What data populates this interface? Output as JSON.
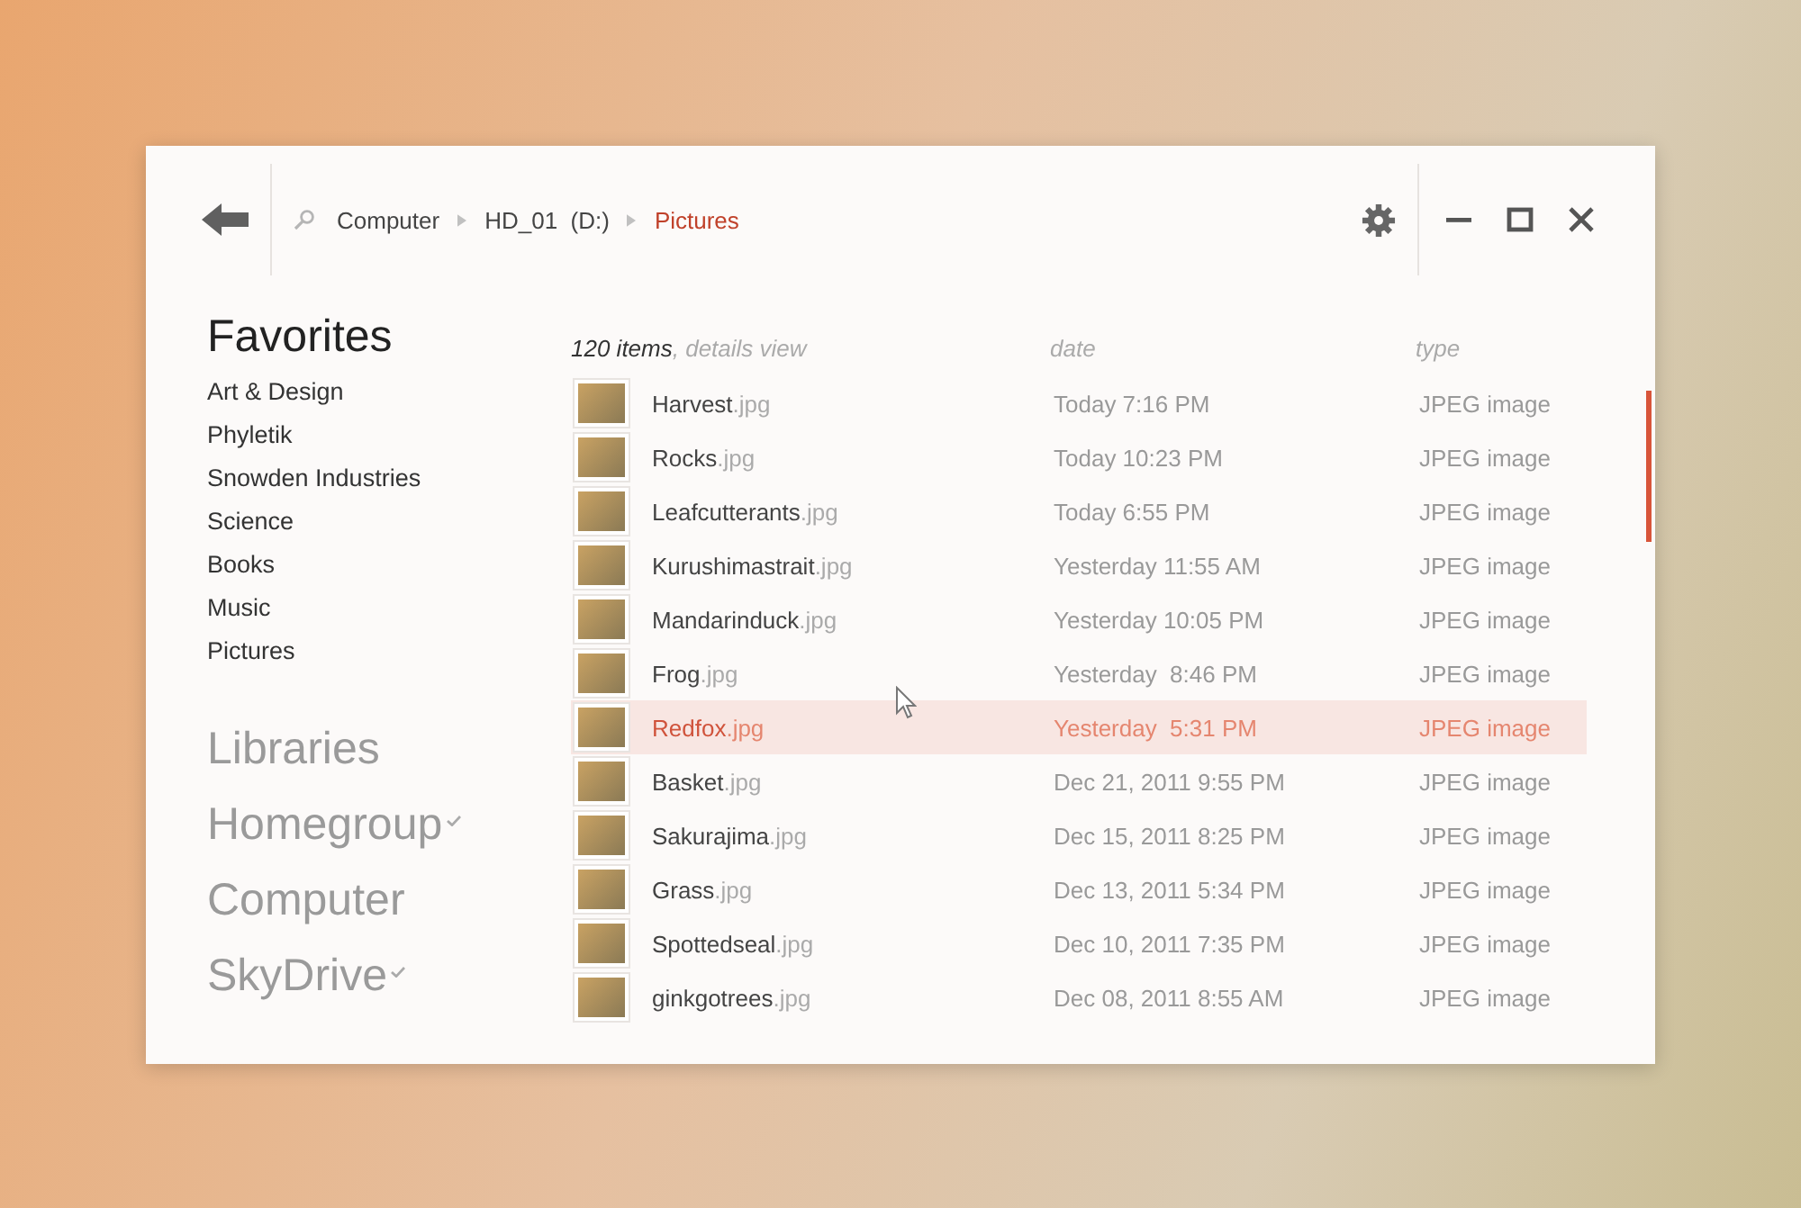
{
  "breadcrumb": [
    {
      "label": "Computer",
      "selected": false
    },
    {
      "label": "HD_01  (D:)",
      "selected": false
    },
    {
      "label": "Pictures",
      "selected": true
    }
  ],
  "favorites": {
    "title": "Favorites",
    "items": [
      "Art & Design",
      "Phyletik",
      "Snowden Industries",
      "Science",
      "Books",
      "Music",
      "Pictures"
    ]
  },
  "locations": [
    {
      "label": "Libraries",
      "checked": false
    },
    {
      "label": "Homegroup",
      "checked": true
    },
    {
      "label": "Computer",
      "checked": false
    },
    {
      "label": "SkyDrive",
      "checked": true
    }
  ],
  "list_header": {
    "count": "120 items",
    "view": ", details view",
    "date": "date",
    "type": "type"
  },
  "files": [
    {
      "name": "Harvest",
      "ext": ".jpg",
      "date": "Today 7:16 PM",
      "type": "JPEG image",
      "selected": false
    },
    {
      "name": "Rocks",
      "ext": ".jpg",
      "date": "Today 10:23 PM",
      "type": "JPEG image",
      "selected": false
    },
    {
      "name": "Leafcutterants",
      "ext": ".jpg",
      "date": "Today 6:55 PM",
      "type": "JPEG image",
      "selected": false
    },
    {
      "name": "Kurushimastrait",
      "ext": ".jpg",
      "date": "Yesterday 11:55 AM",
      "type": "JPEG image",
      "selected": false
    },
    {
      "name": "Mandarinduck",
      "ext": ".jpg",
      "date": "Yesterday 10:05 PM",
      "type": "JPEG image",
      "selected": false
    },
    {
      "name": "Frog",
      "ext": ".jpg",
      "date": "Yesterday  8:46 PM",
      "type": "JPEG image",
      "selected": false
    },
    {
      "name": "Redfox",
      "ext": ".jpg",
      "date": "Yesterday  5:31 PM",
      "type": "JPEG image",
      "selected": true
    },
    {
      "name": "Basket",
      "ext": ".jpg",
      "date": "Dec 21, 2011 9:55 PM",
      "type": "JPEG image",
      "selected": false
    },
    {
      "name": "Sakurajima",
      "ext": ".jpg",
      "date": "Dec 15, 2011 8:25 PM",
      "type": "JPEG image",
      "selected": false
    },
    {
      "name": "Grass",
      "ext": ".jpg",
      "date": "Dec 13, 2011 5:34 PM",
      "type": "JPEG image",
      "selected": false
    },
    {
      "name": "Spottedseal",
      "ext": ".jpg",
      "date": "Dec 10, 2011 7:35 PM",
      "type": "JPEG image",
      "selected": false
    },
    {
      "name": "ginkgotrees",
      "ext": ".jpg",
      "date": "Dec 08, 2011 8:55 AM",
      "type": "JPEG image",
      "selected": false
    }
  ]
}
